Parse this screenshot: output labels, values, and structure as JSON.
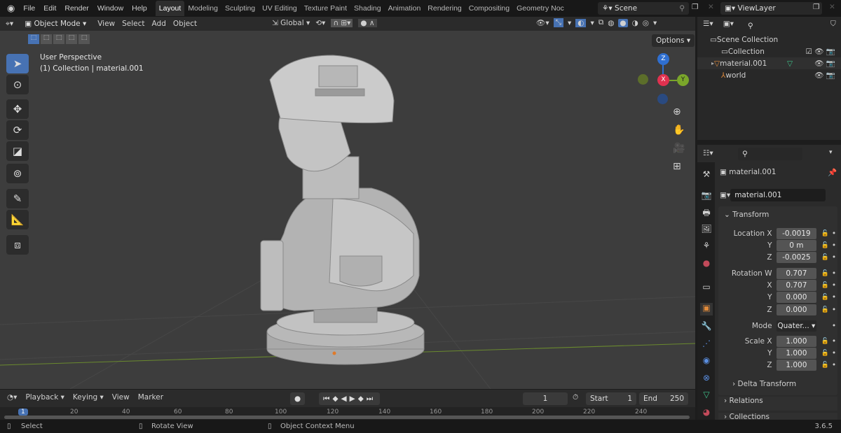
{
  "topbar": {
    "menu": [
      "File",
      "Edit",
      "Render",
      "Window",
      "Help"
    ],
    "tabs": [
      "Layout",
      "Modeling",
      "Sculpting",
      "UV Editing",
      "Texture Paint",
      "Shading",
      "Animation",
      "Rendering",
      "Compositing",
      "Geometry Noc"
    ],
    "active_tab": "Layout",
    "scene": "Scene",
    "view_layer": "ViewLayer"
  },
  "viewport_header": {
    "mode": "Object Mode",
    "menus": [
      "View",
      "Select",
      "Add",
      "Object"
    ],
    "orientation": "Global",
    "options": "Options"
  },
  "viewport": {
    "perspective": "User Perspective",
    "context": "(1) Collection | material.001",
    "gizmo": {
      "z": "Z",
      "x": "X",
      "y": "Y"
    }
  },
  "outliner": {
    "items": [
      {
        "label": "Scene Collection"
      },
      {
        "label": "Collection"
      },
      {
        "label": "material.001"
      },
      {
        "label": "world"
      }
    ]
  },
  "properties": {
    "object_name": "material.001",
    "data_name": "material.001",
    "transform_label": "Transform",
    "rows": [
      {
        "label": "Location X",
        "value": "-0.0019"
      },
      {
        "label": "Y",
        "value": "0 m"
      },
      {
        "label": "Z",
        "value": "-0.0025"
      },
      {
        "label": "Rotation W",
        "value": "0.707"
      },
      {
        "label": "X",
        "value": "0.707"
      },
      {
        "label": "Y",
        "value": "0.000"
      },
      {
        "label": "Z",
        "value": "0.000"
      },
      {
        "label": "Mode",
        "value": "Quater..."
      },
      {
        "label": "Scale X",
        "value": "1.000"
      },
      {
        "label": "Y",
        "value": "1.000"
      },
      {
        "label": "Z",
        "value": "1.000"
      }
    ],
    "delta": "Delta Transform",
    "relations": "Relations",
    "collections": "Collections"
  },
  "timeline": {
    "menus": [
      "Playback",
      "Keying",
      "View",
      "Marker"
    ],
    "current_frame": "1",
    "start_label": "Start",
    "start": "1",
    "end_label": "End",
    "end": "250",
    "ticks": [
      "1",
      "20",
      "40",
      "60",
      "80",
      "100",
      "120",
      "140",
      "160",
      "180",
      "200",
      "220",
      "240"
    ]
  },
  "status": {
    "select": "Select",
    "rotate": "Rotate View",
    "context": "Object Context Menu",
    "version": "3.6.5"
  }
}
